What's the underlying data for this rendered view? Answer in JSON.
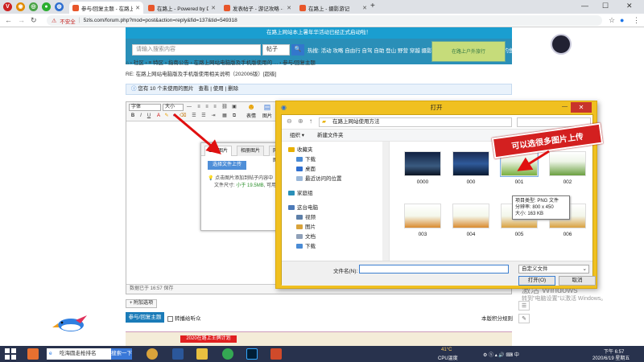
{
  "browser": {
    "pinned": [
      {
        "name": "vivaldi-pinned-tab",
        "glyph": "V",
        "color": "#cc2222"
      },
      {
        "name": "weibo-pinned-tab",
        "glyph": "◉",
        "color": "#e28a00"
      },
      {
        "name": "rss-pinned-tab",
        "glyph": "◎",
        "color": "#4aa347"
      },
      {
        "name": "wechat-pinned-tab",
        "glyph": "●",
        "color": "#2bae30"
      },
      {
        "name": "store-pinned-tab",
        "glyph": "◍",
        "color": "#2f6fd0"
      }
    ],
    "tabs": [
      {
        "title": "参与/回复主题 - 在路上网站电脑",
        "active": true,
        "icon_color": "#e8562a"
      },
      {
        "title": "在路上 - Powered by Discuz!",
        "active": false,
        "icon_color": "#e8562a"
      },
      {
        "title": "发表帖子 - 游记攻略 - 在路上",
        "active": false,
        "icon_color": "#e8562a"
      },
      {
        "title": "在路上 - 摄影游记",
        "active": false,
        "icon_color": "#e8562a"
      }
    ],
    "new_tab": "+",
    "security_label": "不安全",
    "url": "5zls.com/forum.php?mod=post&action=reply&fid=137&tid=549318"
  },
  "forum": {
    "banner_text": "在路上网站本上暑年华活动已经正式启动啦！",
    "search_placeholder": "请输入搜索内容",
    "search_scope": "帖子",
    "search_tags": "热搜: 活动 攻略 自由行 自驾 自助 登山 野营 穿越 摄影 探险 徒步 亲子 漫步三清 越野 钓鱼",
    "ad_text": "在路上户外旅行",
    "breadcrumb": "⌂ › 社区 › ≡ 特区 › 指南公告 › 在路上网站电脑版及手机版使用的 ... › 参与/回复主题",
    "reply_title": "RE: 在路上网站电脑版及手机版使用相关说明（202006版）[超级]",
    "notice_text": "您有 10 个未使用的图片",
    "notice_view": "查看",
    "notice_use": "使用",
    "notice_delete": "删除",
    "toolbar_font": "字体",
    "toolbar_size": "大小",
    "emoji_labels": [
      "表情",
      "图片",
      "附件"
    ],
    "upload_tabs": [
      "上传图片",
      "相册图片",
      "网络图片"
    ],
    "upload_button": "选择文件上传",
    "upload_tip_line1": "点击图片添加到帖子内容中",
    "upload_tip_prefix": "文件尺寸: ",
    "upload_tip_size": "小于 19.5MB",
    "upload_tip_suffix": ", 可用",
    "status_text": "数据已于 16:57 保存",
    "extra_options": "+ 附加选项",
    "post_button": "参与/回复主题",
    "subscribe_label": "转播给听众",
    "credit_rule": "本版积分规则",
    "footer_badge": "2020在路上王牌计划"
  },
  "dialog": {
    "title": "打开",
    "path": "在路上网站使用方法",
    "organize": "组织 ▾",
    "new_folder": "新建文件夹",
    "tree": [
      {
        "label": "收藏夹",
        "color": "#e8b000",
        "indent": 0
      },
      {
        "label": "下载",
        "color": "#4a8bd5",
        "indent": 1
      },
      {
        "label": "桌面",
        "color": "#2f6fd0",
        "indent": 1
      },
      {
        "label": "最近访问的位置",
        "color": "#9bb8d9",
        "indent": 1
      },
      {
        "label": "家庭组",
        "color": "#2a8fb8",
        "indent": 0
      },
      {
        "label": "这台电脑",
        "color": "#4c7ab8",
        "indent": 0
      },
      {
        "label": "视频",
        "color": "#5d7fa8",
        "indent": 1
      },
      {
        "label": "图片",
        "color": "#d9a33b",
        "indent": 1
      },
      {
        "label": "文档",
        "color": "#8fa0b8",
        "indent": 1
      },
      {
        "label": "下载",
        "color": "#4a8bd5",
        "indent": 1
      }
    ],
    "files": [
      "0000",
      "000",
      "001",
      "002",
      "003",
      "004",
      "005",
      "006"
    ],
    "tooltip_line1": "项目类型: PNG 文件",
    "tooltip_line2": "分辨率: 800 x 450",
    "tooltip_line3": "大小: 163 KB",
    "filename_label": "文件名(N):",
    "filename_value": "",
    "filetype": "自定义文件",
    "open_button": "打开(O)",
    "cancel_button": "取消"
  },
  "callout_text": "可以选很多图片上传",
  "watermark_line1": "激活 Windows",
  "watermark_line2": "转到\"电脑设置\"以激活 Windows。",
  "taskbar": {
    "search_text": "吃海圆走枪排名",
    "search_button": "搜索一下",
    "temperature": "41°C",
    "cpu_label": "CPU温度",
    "time": "下午 6:57",
    "date": "2020/6/19 星期五"
  },
  "colors": {
    "accent": "#1a9ed0",
    "dialog_frame": "#f0c020",
    "callout": "#d32020",
    "arrow": "#e01010"
  }
}
